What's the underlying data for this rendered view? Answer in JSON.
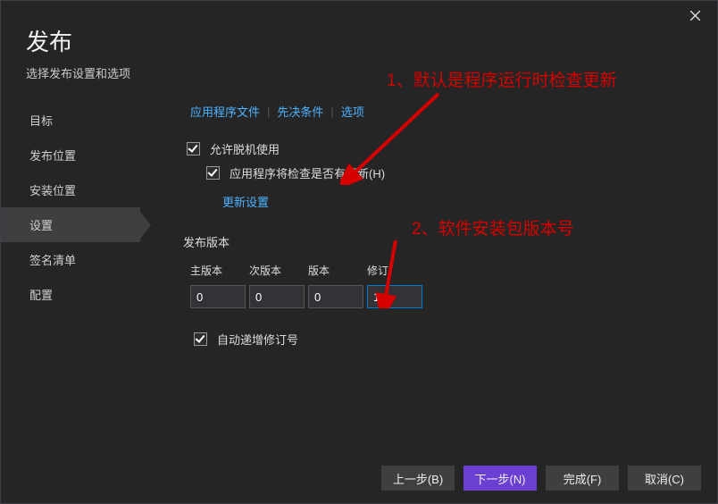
{
  "header": {
    "title": "发布",
    "subtitle": "选择发布设置和选项"
  },
  "sidebar": {
    "items": [
      {
        "label": "目标"
      },
      {
        "label": "发布位置"
      },
      {
        "label": "安装位置"
      },
      {
        "label": "设置"
      },
      {
        "label": "签名清单"
      },
      {
        "label": "配置"
      }
    ],
    "selected": 3
  },
  "linkbar": {
    "app_files": "应用程序文件",
    "prereq": "先决条件",
    "options": "选项"
  },
  "checks": {
    "offline": "允许脱机使用",
    "check_updates": "应用程序将检查是否有更新(H)",
    "update_settings": "更新设置",
    "auto_increment": "自动递增修订号"
  },
  "version": {
    "section": "发布版本",
    "major_lbl": "主版本",
    "minor_lbl": "次版本",
    "build_lbl": "版本",
    "rev_lbl": "修订",
    "major": "0",
    "minor": "0",
    "build": "0",
    "rev": "1"
  },
  "footer": {
    "back": "上一步(B)",
    "next": "下一步(N)",
    "finish": "完成(F)",
    "cancel": "取消(C)"
  },
  "annotations": {
    "a1": "1、默认是程序运行时检查更新",
    "a2": "2、软件安装包版本号"
  }
}
